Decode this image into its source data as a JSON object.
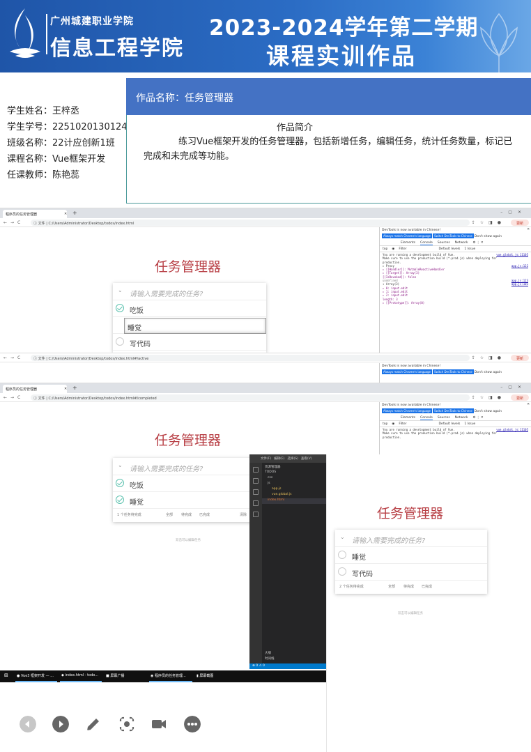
{
  "banner": {
    "school": "广州城建职业学院",
    "college": "信息工程学院",
    "term": "2023-2024学年第二学期",
    "course_work_title": "课程实训作品"
  },
  "student": {
    "name_label": "学生姓名：",
    "name": "王梓丞",
    "id_label": "学生学号：",
    "id": "2251020130124",
    "class_label": "班级名称：",
    "class": "22计应创新1班",
    "course_label": "课程名称：",
    "course": "Vue框架开发",
    "teacher_label": "任课教师：",
    "teacher": "陈艳蕊"
  },
  "work": {
    "title": "作品名称：任务管理器",
    "intro_heading": "作品简介",
    "intro_text": "练习Vue框架开发的任务管理器，包括新增任务，编辑任务，统计任务数量，标记已完成和未完成等功能。"
  },
  "screenshots": {
    "browser1": {
      "tab_title": "程序员的任务管理器",
      "url_prefix": "文件",
      "url": "C:/Users/Administrator/Desktop/todos/index.html",
      "update_label": "更新",
      "app_title": "任务管理器",
      "placeholder": "请输入需要完成的任务?",
      "todos": [
        {
          "text": "吃饭",
          "done": true
        },
        {
          "text": "睡觉",
          "done": false,
          "editing": true
        },
        {
          "text": "写代码",
          "done": false
        }
      ]
    },
    "browser2": {
      "url_prefix": "文件",
      "url": "C:/Users/Administrator/Desktop/todos/index.html#/active",
      "update_label": "更新"
    },
    "browser3": {
      "tab_title": "程序员的任务管理器",
      "url_prefix": "文件",
      "url": "C:/Users/Administrator/Desktop/todos/index.html#/completed",
      "update_label": "更新",
      "app_title": "任务管理器",
      "placeholder": "请输入需要完成的任务?",
      "todos": [
        {
          "text": "吃饭",
          "done": true
        },
        {
          "text": "睡觉",
          "done": true
        }
      ],
      "count_text": "1 个任务待完成",
      "filters": [
        "全部",
        "待完成",
        "已完成"
      ],
      "clear_text": "清除",
      "hint": "双击可以编辑任务"
    },
    "app4": {
      "app_title": "任务管理器",
      "placeholder": "请输入需要完成的任务?",
      "todos": [
        {
          "text": "睡觉",
          "done": false
        },
        {
          "text": "写代码",
          "done": false
        }
      ],
      "count_text": "2 个任务待完成",
      "filters": [
        "全部",
        "待完成",
        "已完成"
      ],
      "hint": "双击可以编辑任务"
    },
    "devtools": {
      "notice": "DevTools is now available in Chinese!",
      "btn_match": "Always match Chrome's language",
      "btn_switch": "Switch DevTools to Chinese",
      "btn_dont": "Don't show again",
      "tabs": [
        "Elements",
        "Console",
        "Sources",
        "Network"
      ],
      "filter_context": "top",
      "filter_placeholder": "Filter",
      "levels": "Default levels",
      "issues": "1 Issue",
      "console_lines": [
        {
          "text": "You are running a development build of Vue.",
          "link": "vue.global.js:11105"
        },
        {
          "text": "Make sure to use the production build (*.prod.js) when deploying for",
          "link": ""
        },
        {
          "text": "production.",
          "link": ""
        },
        {
          "text": "▸ Proxy",
          "link": "app.js:122"
        },
        {
          "text": "  ▸ [[Handler]]: MutableReactiveHandler",
          "link": ""
        },
        {
          "text": "  ▸ [[Target]]: Array(3)",
          "link": ""
        },
        {
          "text": "    [[IsRevoked]]: false",
          "link": ""
        },
        {
          "text": "undefined",
          "link": "app.js:123"
        },
        {
          "text": "▾ Array(3)",
          "link": "app.js:103"
        },
        {
          "text": "  ▸ 0: input.edit",
          "link": ""
        },
        {
          "text": "  ▸ 1: input.edit",
          "link": ""
        },
        {
          "text": "  ▸ 2: input.edit",
          "link": ""
        },
        {
          "text": "    length: 3",
          "link": ""
        },
        {
          "text": "  ▸ [[Prototype]]: Array(0)",
          "link": ""
        }
      ],
      "console_lines_short": [
        {
          "text": "You are running a development build of Vue.",
          "link": "vue.global.js:11105"
        },
        {
          "text": "Make sure to use the production build (*.prod.js) when deploying for",
          "link": ""
        },
        {
          "text": "production.",
          "link": ""
        }
      ]
    },
    "vscode": {
      "menu": [
        "文件(F)",
        "编辑(E)",
        "选择(S)",
        "查看(V)"
      ],
      "explorer_title": "资源管理器",
      "tree": [
        "TODOS",
        "css",
        "js",
        "app.js",
        "vue.global.js",
        "index.html"
      ],
      "outline": "大纲",
      "timeline": "时间线",
      "status": "⊗ 0 ⚠ 0"
    },
    "taskbar": {
      "items": [
        "Vue3 框架开发 — ...",
        "index.html - todo...",
        "屏幕广播",
        "程序员的任务管理...",
        "屏幕截图"
      ]
    }
  },
  "colors": {
    "banner_blue": "#1f55a8",
    "title_bar": "#4472c4",
    "app_title_red": "#b83f45",
    "check_green": "#5dc2af"
  },
  "toolbar_icons": [
    "back-circle-icon",
    "play-circle-icon",
    "pencil-icon",
    "screenshot-icon",
    "camera-icon",
    "more-icon"
  ]
}
